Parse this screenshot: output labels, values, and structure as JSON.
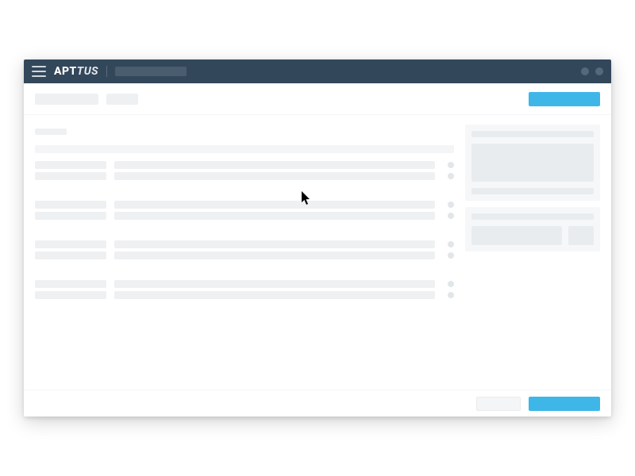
{
  "brand": {
    "part1": "APT",
    "part2": "TUS"
  },
  "colors": {
    "accent": "#3fb6e8",
    "navbar": "#33475b",
    "skeleton": "#eef0f2"
  },
  "list": {
    "groups": 4,
    "rows_per_group": 2
  }
}
